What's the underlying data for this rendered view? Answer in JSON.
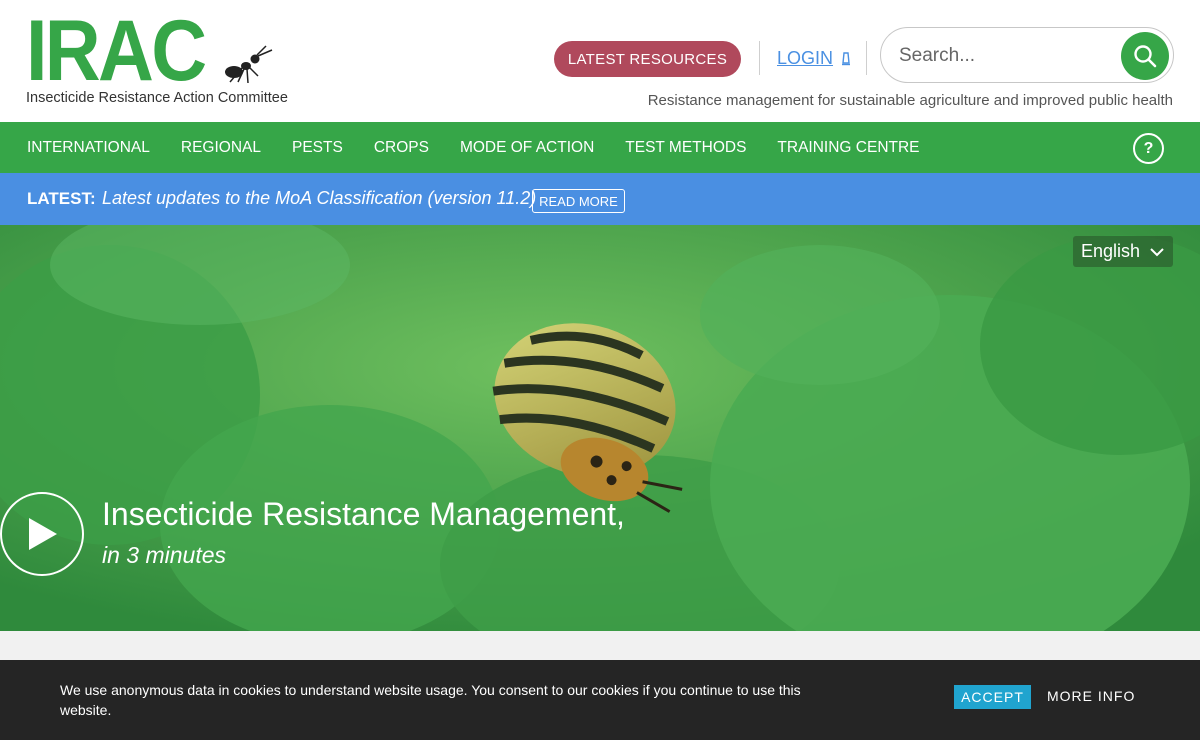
{
  "header": {
    "logo_text": "IRAC",
    "logo_tagline": "Insecticide Resistance Action Committee",
    "resources_label": "LATEST RESOURCES",
    "login_label": "LOGIN",
    "search_placeholder": "Search...",
    "strapline": "Resistance management for sustainable agriculture and improved public health"
  },
  "nav": {
    "items": [
      "INTERNATIONAL",
      "REGIONAL",
      "PESTS",
      "CROPS",
      "MODE OF ACTION",
      "TEST METHODS",
      "TRAINING CENTRE"
    ],
    "help_label": "?"
  },
  "latest": {
    "label": "LATEST:",
    "text": "Latest updates to the MoA Classification (version 11.2)",
    "read_more": "READ MORE"
  },
  "hero": {
    "language": "English",
    "title": "Insecticide Resistance Management,",
    "subtitle": "in 3 minutes"
  },
  "cookie": {
    "text": "We use anonymous data in cookies to understand website usage. You consent to our cookies if you continue to use this website.",
    "accept_label": "ACCEPT",
    "more_info_label": "MORE INFO"
  },
  "colors": {
    "brand_green": "#36a648",
    "resources_button": "#b0495c",
    "latest_bar": "#4a8fe2",
    "login_link": "#4a90e2",
    "accept_button": "#20a4cf",
    "cookie_bg": "#252525"
  },
  "icons": {
    "search": "search-icon",
    "login": "user-icon",
    "help": "help-icon",
    "language": "chevron-down-icon",
    "play": "play-icon",
    "logo_ant": "ant-icon"
  }
}
